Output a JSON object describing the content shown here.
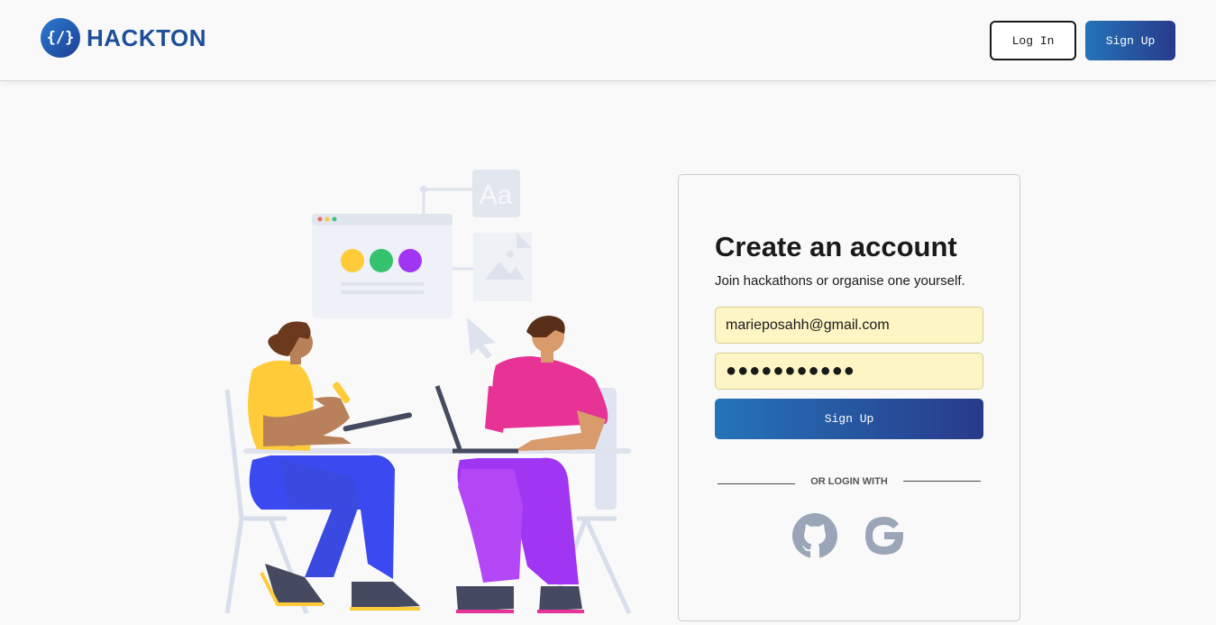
{
  "header": {
    "logo_glyph": "{/}",
    "logo_text": "HACKTON",
    "login_label": "Log In",
    "signup_label": "Sign Up"
  },
  "form": {
    "title": "Create an account",
    "subtitle": "Join hackathons or organise one yourself.",
    "email_value": "marieposahh@gmail.com",
    "password_value": "●●●●●●●●●●●",
    "submit_label": "Sign Up",
    "divider_text": "OR LOGIN WITH",
    "social_icons": [
      "github-icon",
      "google-icon"
    ]
  },
  "colors": {
    "brand": "#1d4f99",
    "gradient_start": "#2574b8",
    "gradient_end": "#283a8a",
    "autofill_bg": "#fdf5c4",
    "social_icon": "#9aa5b8"
  }
}
